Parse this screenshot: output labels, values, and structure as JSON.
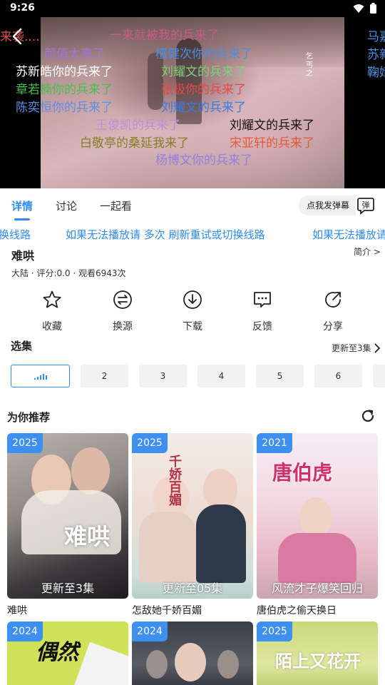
{
  "status_bar": {
    "time": "9:26"
  },
  "player": {
    "danmaku": [
      {
        "text": "来袭....",
        "color": "#e0504f"
      },
      {
        "text": "一来就被我的兵来了",
        "color": "#c95a8a"
      },
      {
        "text": "颜值太高了",
        "color": "#a474d8"
      },
      {
        "text": "檀健次你的兵来了",
        "color": "#4a90e2"
      },
      {
        "text": "苏新皓你的兵来了",
        "color": "#ffffff"
      },
      {
        "text": "刘耀文的兵来了",
        "color": "#7bd37a"
      },
      {
        "text": "章若楠你的兵来了",
        "color": "#45c04a"
      },
      {
        "text": "张极你的兵来了",
        "color": "#e84848"
      },
      {
        "text": "陈奕恒你的兵来了",
        "color": "#5b8ee6"
      },
      {
        "text": "刘耀文的兵来了",
        "color": "#3c7be0"
      },
      {
        "text": "王俊凯的兵来了",
        "color": "#c38ad8"
      },
      {
        "text": "刘耀文的兵来了",
        "color": "#111111"
      },
      {
        "text": "白敬亭的桑延我来了",
        "color": "#8a7c2a"
      },
      {
        "text": "宋亚轩的兵来了",
        "color": "#e25a3a"
      },
      {
        "text": "杨博文你的兵来了",
        "color": "#8e7fe0"
      },
      {
        "text": "马嘉",
        "color": "#4a90e2"
      },
      {
        "text": "苏新",
        "color": "#4a90e2"
      },
      {
        "text": "鞠婧",
        "color": "#4a90e2"
      }
    ],
    "poster_caption": "乞丐之"
  },
  "tabs": [
    {
      "label": "详情"
    },
    {
      "label": "讨论"
    },
    {
      "label": "一起看"
    }
  ],
  "danmaku_input": {
    "placeholder": "点我发弹幕",
    "toggle_label": "弹"
  },
  "notice": {
    "text_left": "换线路",
    "text_main": "如果无法播放请 多次 刷新重试或切换线路",
    "text_right": "如果无法播放请"
  },
  "show": {
    "title": "难哄",
    "intro_link": "简介 >",
    "meta": "大陆 · 评分:0.0 · 观看6943次"
  },
  "actions": [
    {
      "label": "收藏",
      "icon": "star-icon"
    },
    {
      "label": "换源",
      "icon": "swap-icon"
    },
    {
      "label": "下载",
      "icon": "download-icon"
    },
    {
      "label": "反馈",
      "icon": "feedback-icon"
    },
    {
      "label": "分享",
      "icon": "share-icon"
    }
  ],
  "episodes": {
    "title": "选集",
    "update_link": "更新至3集",
    "items": [
      "2",
      "3",
      "4",
      "5",
      "6"
    ]
  },
  "recommend": {
    "title": "为你推荐",
    "cards": [
      {
        "year": "2025",
        "episode": "更新至3集",
        "name": "难哄",
        "art": "难哄"
      },
      {
        "year": "2025",
        "episode": "更新至05集",
        "name": "怎敌她千娇百媚",
        "art": "千娇百媚"
      },
      {
        "year": "2021",
        "episode": "风流才子爆笑回归",
        "name": "唐伯虎之偷天换日",
        "art": "唐伯虎"
      }
    ],
    "cards_row2": [
      {
        "year": "2024",
        "art": "偶然"
      },
      {
        "year": "2024",
        "art": ""
      },
      {
        "year": "2025",
        "art": "陌上又花开"
      }
    ]
  }
}
